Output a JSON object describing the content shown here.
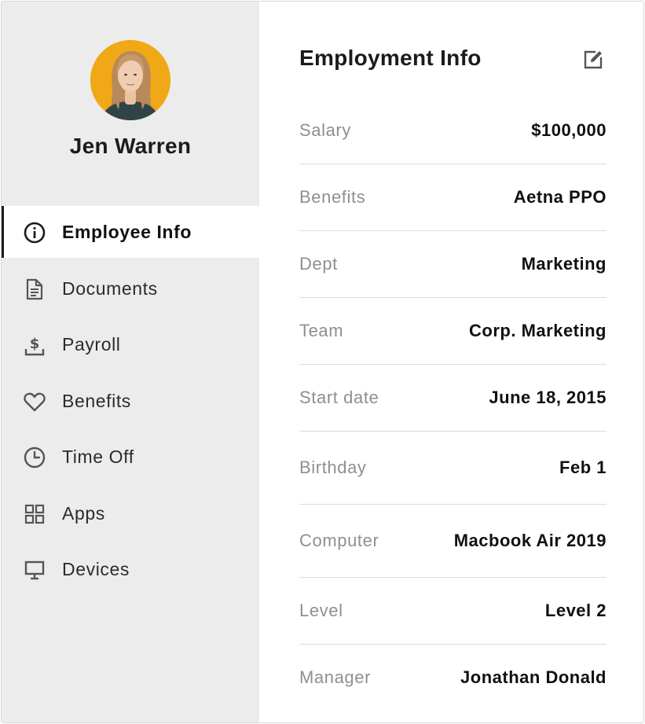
{
  "profile": {
    "name": "Jen Warren",
    "avatar_bg": "#f0a816"
  },
  "sidebar": {
    "items": [
      {
        "label": "Employee Info",
        "icon": "info-icon",
        "active": true
      },
      {
        "label": "Documents",
        "icon": "document-icon",
        "active": false
      },
      {
        "label": "Payroll",
        "icon": "payroll-icon",
        "active": false
      },
      {
        "label": "Benefits",
        "icon": "heart-icon",
        "active": false
      },
      {
        "label": "Time Off",
        "icon": "clock-icon",
        "active": false
      },
      {
        "label": "Apps",
        "icon": "apps-grid-icon",
        "active": false
      },
      {
        "label": "Devices",
        "icon": "monitor-icon",
        "active": false
      }
    ]
  },
  "main": {
    "title": "Employment Info",
    "edit_icon": "edit-icon",
    "fields": [
      {
        "label": "Salary",
        "value": "$100,000"
      },
      {
        "label": "Benefits",
        "value": "Aetna PPO"
      },
      {
        "label": "Dept",
        "value": "Marketing"
      },
      {
        "label": "Team",
        "value": "Corp. Marketing"
      },
      {
        "label": "Start date",
        "value": "June 18, 2015"
      },
      {
        "label": "Birthday",
        "value": "Feb 1"
      },
      {
        "label": "Computer",
        "value": "Macbook Air 2019"
      },
      {
        "label": "Level",
        "value": "Level 2"
      },
      {
        "label": "Manager",
        "value": "Jonathan Donald"
      }
    ]
  },
  "colors": {
    "sidebar_bg": "#ececec",
    "active_item_bg": "#ffffff",
    "text_primary": "#1b1b1b",
    "text_muted": "#8f8f8f",
    "divider": "#dcdcdc"
  }
}
